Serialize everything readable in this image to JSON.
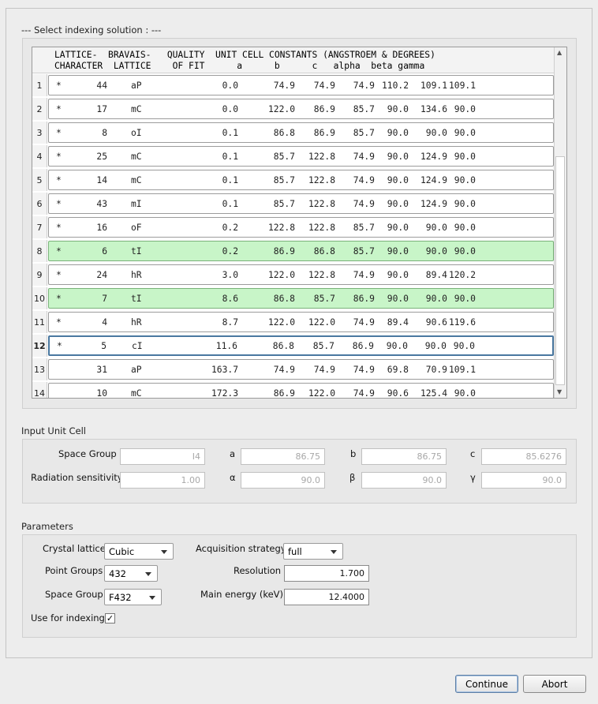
{
  "select_section": {
    "title": "--- Select indexing solution : ---"
  },
  "table": {
    "header_line1": "LATTICE-  BRAVAIS-   QUALITY  UNIT CELL CONSTANTS (ANGSTROEM & DEGREES)",
    "header_line2": "CHARACTER  LATTICE    OF FIT      a      b      c   alpha  beta gamma",
    "rows": [
      {
        "num": "1",
        "star": "*",
        "lc": "44",
        "bl": "aP",
        "q": "0.0",
        "a": "74.9",
        "b": "74.9",
        "c": "74.9",
        "alpha": "110.2",
        "beta": "109.1",
        "gamma": "109.1",
        "highlight": "none"
      },
      {
        "num": "2",
        "star": "*",
        "lc": "17",
        "bl": "mC",
        "q": "0.0",
        "a": "122.0",
        "b": "86.9",
        "c": "85.7",
        "alpha": "90.0",
        "beta": "134.6",
        "gamma": "90.0",
        "highlight": "none"
      },
      {
        "num": "3",
        "star": "*",
        "lc": "8",
        "bl": "oI",
        "q": "0.1",
        "a": "86.8",
        "b": "86.9",
        "c": "85.7",
        "alpha": "90.0",
        "beta": "90.0",
        "gamma": "90.0",
        "highlight": "none"
      },
      {
        "num": "4",
        "star": "*",
        "lc": "25",
        "bl": "mC",
        "q": "0.1",
        "a": "85.7",
        "b": "122.8",
        "c": "74.9",
        "alpha": "90.0",
        "beta": "124.9",
        "gamma": "90.0",
        "highlight": "none"
      },
      {
        "num": "5",
        "star": "*",
        "lc": "14",
        "bl": "mC",
        "q": "0.1",
        "a": "85.7",
        "b": "122.8",
        "c": "74.9",
        "alpha": "90.0",
        "beta": "124.9",
        "gamma": "90.0",
        "highlight": "none"
      },
      {
        "num": "6",
        "star": "*",
        "lc": "43",
        "bl": "mI",
        "q": "0.1",
        "a": "85.7",
        "b": "122.8",
        "c": "74.9",
        "alpha": "90.0",
        "beta": "124.9",
        "gamma": "90.0",
        "highlight": "none"
      },
      {
        "num": "7",
        "star": "*",
        "lc": "16",
        "bl": "oF",
        "q": "0.2",
        "a": "122.8",
        "b": "122.8",
        "c": "85.7",
        "alpha": "90.0",
        "beta": "90.0",
        "gamma": "90.0",
        "highlight": "none"
      },
      {
        "num": "8",
        "star": "*",
        "lc": "6",
        "bl": "tI",
        "q": "0.2",
        "a": "86.9",
        "b": "86.8",
        "c": "85.7",
        "alpha": "90.0",
        "beta": "90.0",
        "gamma": "90.0",
        "highlight": "green"
      },
      {
        "num": "9",
        "star": "*",
        "lc": "24",
        "bl": "hR",
        "q": "3.0",
        "a": "122.0",
        "b": "122.8",
        "c": "74.9",
        "alpha": "90.0",
        "beta": "89.4",
        "gamma": "120.2",
        "highlight": "none"
      },
      {
        "num": "10",
        "star": "*",
        "lc": "7",
        "bl": "tI",
        "q": "8.6",
        "a": "86.8",
        "b": "85.7",
        "c": "86.9",
        "alpha": "90.0",
        "beta": "90.0",
        "gamma": "90.0",
        "highlight": "green"
      },
      {
        "num": "11",
        "star": "*",
        "lc": "4",
        "bl": "hR",
        "q": "8.7",
        "a": "122.0",
        "b": "122.0",
        "c": "74.9",
        "alpha": "89.4",
        "beta": "90.6",
        "gamma": "119.6",
        "highlight": "none"
      },
      {
        "num": "12",
        "star": "*",
        "lc": "5",
        "bl": "cI",
        "q": "11.6",
        "a": "86.8",
        "b": "85.7",
        "c": "86.9",
        "alpha": "90.0",
        "beta": "90.0",
        "gamma": "90.0",
        "highlight": "selected"
      },
      {
        "num": "13",
        "star": "",
        "lc": "31",
        "bl": "aP",
        "q": "163.7",
        "a": "74.9",
        "b": "74.9",
        "c": "74.9",
        "alpha": "69.8",
        "beta": "70.9",
        "gamma": "109.1",
        "highlight": "none"
      },
      {
        "num": "14",
        "star": "",
        "lc": "10",
        "bl": "mC",
        "q": "172.3",
        "a": "86.9",
        "b": "122.0",
        "c": "74.9",
        "alpha": "90.6",
        "beta": "125.4",
        "gamma": "90.0",
        "highlight": "none"
      }
    ]
  },
  "input_unit_cell": {
    "title": "Input Unit Cell",
    "space_group_label": "Space Group",
    "space_group_value": "I4",
    "a_label": "a",
    "a_value": "86.75",
    "b_label": "b",
    "b_value": "86.75",
    "c_label": "c",
    "c_value": "85.6276",
    "radiation_label": "Radiation sensitivity",
    "radiation_value": "1.00",
    "alpha_label": "α",
    "alpha_value": "90.0",
    "beta_label": "β",
    "beta_value": "90.0",
    "gamma_label": "γ",
    "gamma_value": "90.0"
  },
  "parameters": {
    "title": "Parameters",
    "crystal_lattice_label": "Crystal lattice",
    "crystal_lattice_value": "Cubic",
    "acquisition_label": "Acquisition strategy",
    "acquisition_value": "full",
    "point_groups_label": "Point Groups",
    "point_groups_value": "432",
    "resolution_label": "Resolution",
    "resolution_value": "1.700",
    "space_group_label": "Space Group",
    "space_group_value": "F432",
    "energy_label": "Main energy (keV)",
    "energy_value": "12.4000",
    "use_for_indexing_label": "Use for indexing",
    "use_for_indexing_checked": "✓"
  },
  "buttons": {
    "continue": "Continue",
    "abort": "Abort"
  },
  "colors": {
    "highlight_green": "#c8f5c8",
    "selected_border": "#4a78a0"
  }
}
